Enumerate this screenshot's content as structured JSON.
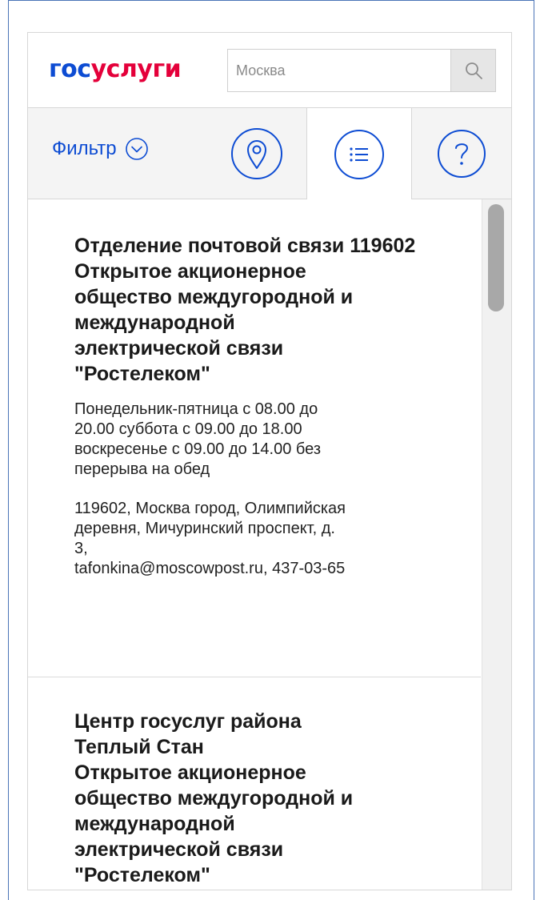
{
  "header": {
    "logo_part1": "гос",
    "logo_part2": "услуги",
    "search": {
      "placeholder": "Москва",
      "value": ""
    }
  },
  "toolbar": {
    "filter_label": "Фильтр",
    "tabs": [
      {
        "name": "map",
        "icon": "map-pin-icon",
        "active": false
      },
      {
        "name": "list",
        "icon": "list-icon",
        "active": true
      },
      {
        "name": "help",
        "icon": "question-icon",
        "active": false
      }
    ]
  },
  "colors": {
    "brand_blue": "#0d4cd3",
    "brand_red": "#e4003a",
    "frame_blue": "#4a74b7"
  },
  "offices": [
    {
      "title": "Отделение почтовой связи 119602",
      "organization": "Открытое акционерное\nобщество междугородной и\nмеждународной\nэлектрической связи\n\"Ростелеком\"",
      "hours": "Понедельник-пятница с 08.00 до\n20.00 суббота с 09.00 до 18.00\nвоскресенье с 09.00 до 14.00 без\nперерыва на обед",
      "address": "119602, Москва город, Олимпийская\nдеревня, Мичуринский проспект, д.\n3,\ntafonkina@moscowpost.ru, 437-03-65"
    },
    {
      "title": "Центр госуслуг района\nТеплый Стан",
      "organization": "Открытое акционерное\nобщество междугородной и\nмеждународной\nэлектрической связи\n\"Ростелеком\"",
      "hours": "",
      "address": ""
    }
  ]
}
